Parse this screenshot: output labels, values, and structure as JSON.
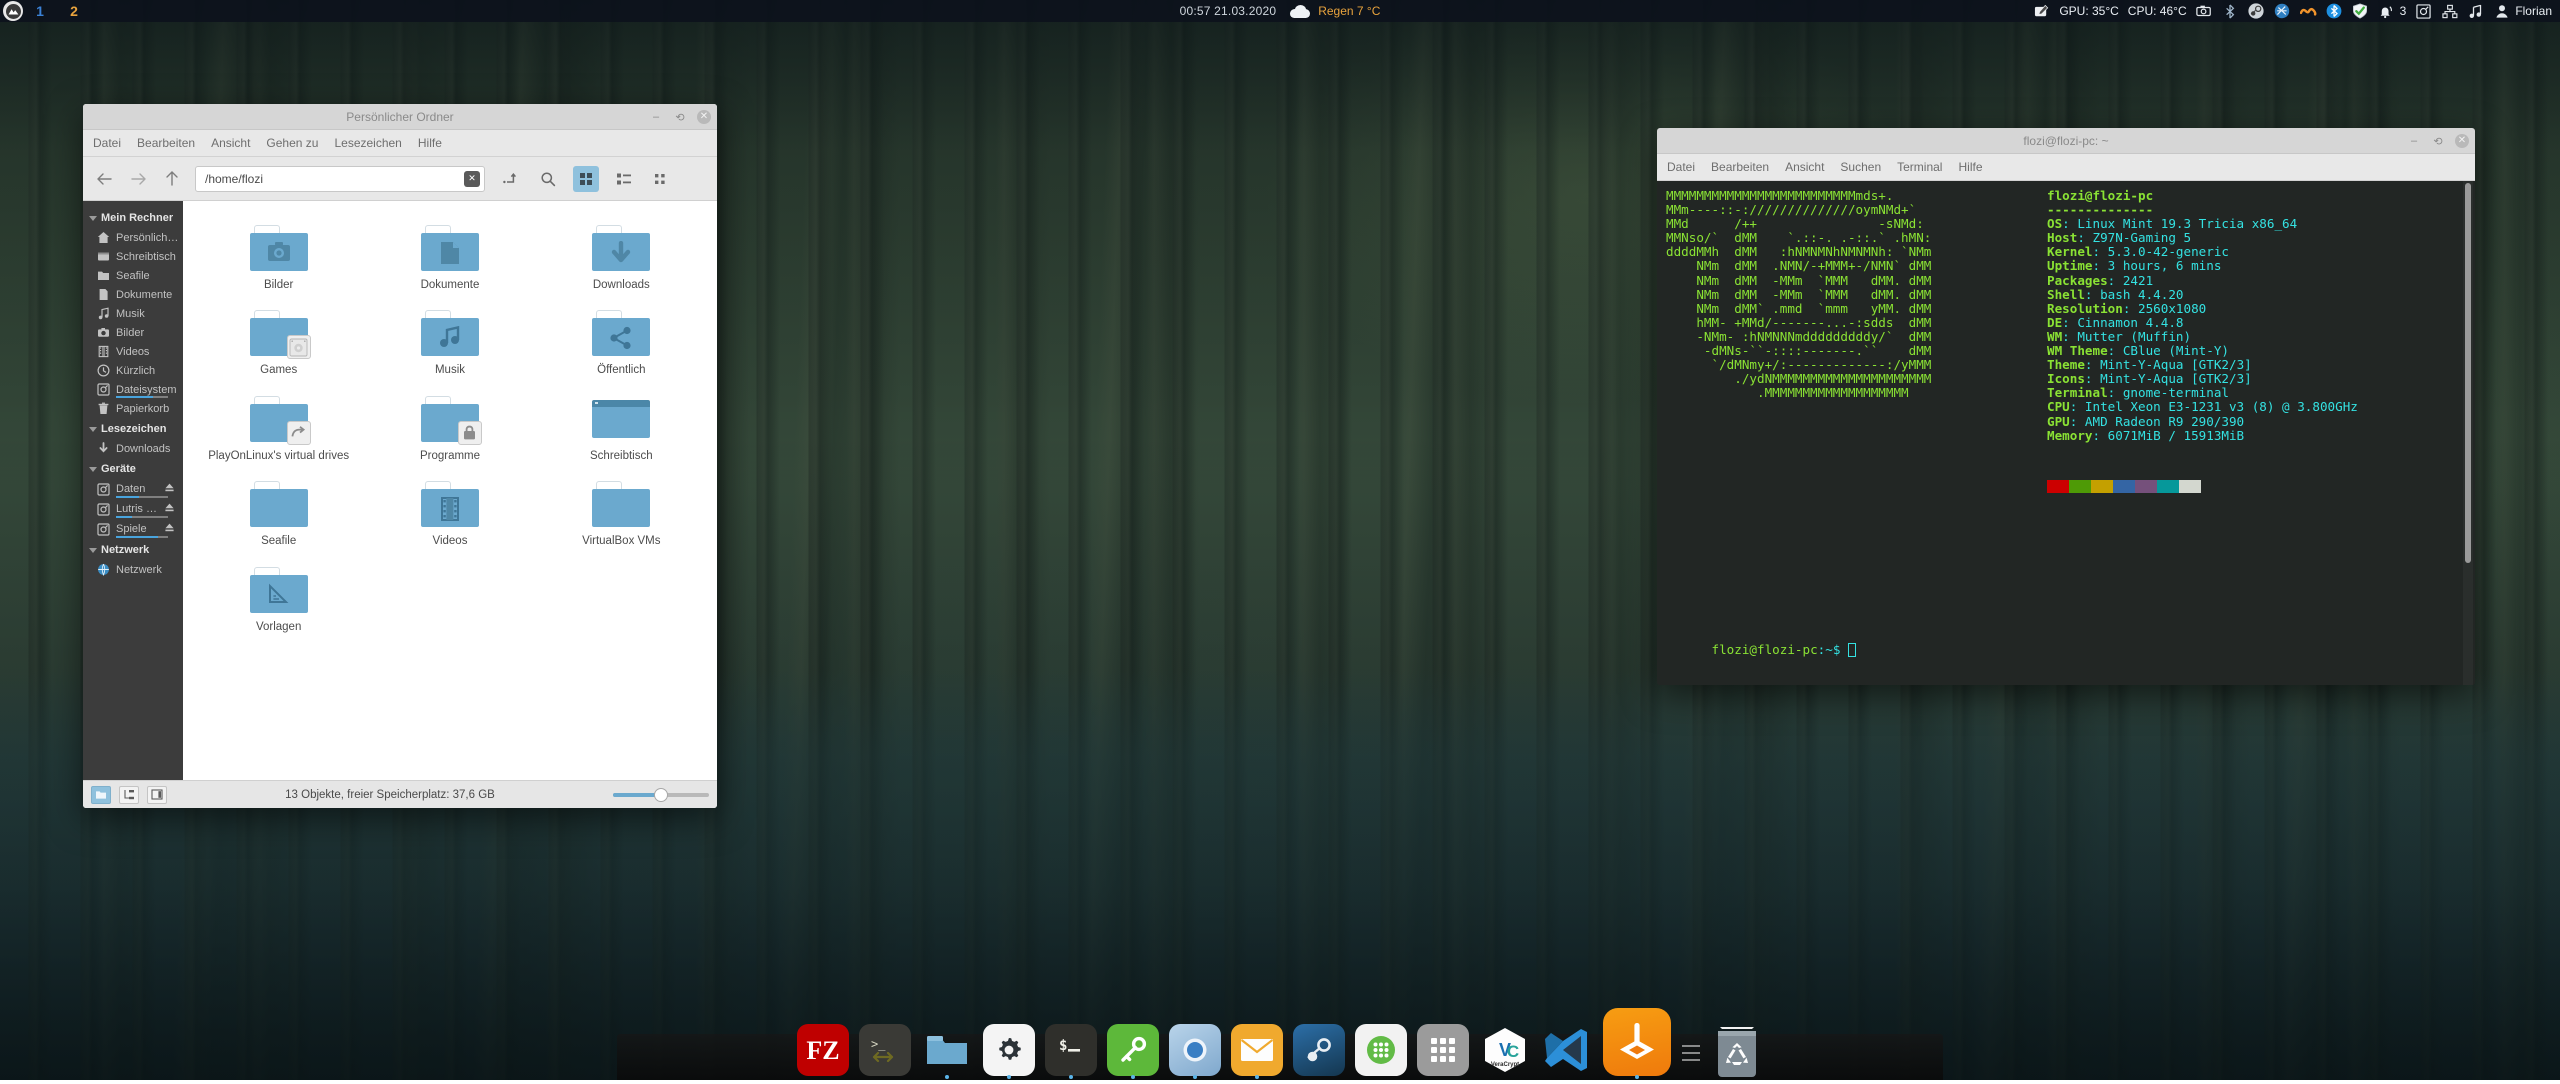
{
  "panel": {
    "menu_icon": "mint-logo-icon",
    "workspaces": [
      {
        "label": "1",
        "active": true
      },
      {
        "label": "2",
        "active": false
      }
    ],
    "clock": "00:57  21.03.2020",
    "weather": {
      "icon": "cloud-icon",
      "text": "Regen 7 °C"
    },
    "tray": {
      "gpu": "GPU: 35°C",
      "cpu": "CPU: 46°C",
      "notification_count": "3",
      "icons": [
        "screenshot-pen-icon",
        "camera-icon",
        "bluetooth-small-icon",
        "steam-icon",
        "synergy-icon",
        "nextcloud-icon",
        "bluetooth-icon",
        "shield-check-icon",
        "bell-icon",
        "removable-drive-icon",
        "network-icon",
        "audio-icon"
      ],
      "user": "Florian",
      "user_icon": "user-avatar-icon"
    }
  },
  "nemo": {
    "title": "Persönlicher Ordner",
    "menu": [
      "Datei",
      "Bearbeiten",
      "Ansicht",
      "Gehen zu",
      "Lesezeichen",
      "Hilfe"
    ],
    "window_buttons": {
      "minimize": "–",
      "maximize": "⟲",
      "close": "✕"
    },
    "path": "/home/flozi",
    "toolbar_icons": [
      "back-icon",
      "forward-icon",
      "up-icon",
      "clear-icon",
      "terminal-here-icon",
      "search-icon",
      "icon-view-icon",
      "list-view-icon",
      "compact-view-icon"
    ],
    "sidebar": [
      {
        "type": "header",
        "label": "Mein Rechner"
      },
      {
        "type": "item",
        "label": "Persönliche…",
        "icon": "home-icon"
      },
      {
        "type": "item",
        "label": "Schreibtisch",
        "icon": "desktop-icon"
      },
      {
        "type": "item",
        "label": "Seafile",
        "icon": "folder-icon"
      },
      {
        "type": "item",
        "label": "Dokumente",
        "icon": "document-icon"
      },
      {
        "type": "item",
        "label": "Musik",
        "icon": "music-note-icon"
      },
      {
        "type": "item",
        "label": "Bilder",
        "icon": "camera-icon"
      },
      {
        "type": "item",
        "label": "Videos",
        "icon": "film-icon"
      },
      {
        "type": "item",
        "label": "Kürzlich",
        "icon": "clock-icon"
      },
      {
        "type": "item",
        "label": "Dateisystem",
        "icon": "drive-icon",
        "usage": 72
      },
      {
        "type": "item",
        "label": "Papierkorb",
        "icon": "trash-icon"
      },
      {
        "type": "header",
        "label": "Lesezeichen"
      },
      {
        "type": "item",
        "label": "Downloads",
        "icon": "download-icon"
      },
      {
        "type": "header",
        "label": "Geräte"
      },
      {
        "type": "item",
        "label": "Daten",
        "icon": "drive-icon",
        "usage": 45,
        "eject": true
      },
      {
        "type": "item",
        "label": "Lutris Games",
        "icon": "drive-icon",
        "usage": 30,
        "eject": true
      },
      {
        "type": "item",
        "label": "Spiele",
        "icon": "drive-icon",
        "usage": 80,
        "eject": true
      },
      {
        "type": "header",
        "label": "Netzwerk"
      },
      {
        "type": "item",
        "label": "Netzwerk",
        "icon": "globe-icon"
      }
    ],
    "files": [
      {
        "name": "Bilder",
        "kind": "folder",
        "emblem": "camera-icon"
      },
      {
        "name": "Dokumente",
        "kind": "folder",
        "emblem": "document-icon"
      },
      {
        "name": "Downloads",
        "kind": "folder",
        "emblem": "download-arrow-icon"
      },
      {
        "name": "Games",
        "kind": "folder",
        "emblem": "none",
        "badge": "drive-badge-icon"
      },
      {
        "name": "Musik",
        "kind": "folder",
        "emblem": "music-note-icon"
      },
      {
        "name": "Öffentlich",
        "kind": "folder",
        "emblem": "share-icon"
      },
      {
        "name": "PlayOnLinux's virtual drives",
        "kind": "folder",
        "emblem": "none",
        "badge": "link-badge-icon"
      },
      {
        "name": "Programme",
        "kind": "folder",
        "emblem": "none",
        "badge": "lock-badge-icon"
      },
      {
        "name": "Schreibtisch",
        "kind": "desktop",
        "emblem": "none"
      },
      {
        "name": "Seafile",
        "kind": "folder",
        "emblem": "none"
      },
      {
        "name": "Videos",
        "kind": "folder",
        "emblem": "film-icon"
      },
      {
        "name": "VirtualBox VMs",
        "kind": "folder",
        "emblem": "none"
      },
      {
        "name": "Vorlagen",
        "kind": "folder",
        "emblem": "ruler-icon"
      }
    ],
    "status": "13 Objekte, freier Speicherplatz: 37,6 GB",
    "zoom_percent": 50,
    "status_buttons": [
      "icon-view-toggle",
      "tree-view-toggle",
      "sidebar-toggle"
    ]
  },
  "terminal": {
    "title": "flozi@flozi-pc: ~",
    "menu": [
      "Datei",
      "Bearbeiten",
      "Ansicht",
      "Suchen",
      "Terminal",
      "Hilfe"
    ],
    "window_buttons": {
      "minimize": "–",
      "maximize": "⟲",
      "close": "✕"
    },
    "ascii_art": "MMMMMMMMMMMMMMMMMMMMMMMMMmds+.\nMMm----::-://////////////oymNMd+`\nMMd      /++                -sNMd:\nMMNso/`  dMM    `.::-. .-::.` .hMN:\nddddMMh  dMM   :hNMNMNhNMNMNh: `NMm\n    NMm  dMM  .NMN/-+MMM+-/NMN` dMM\n    NMm  dMM  -MMm  `MMM   dMM. dMM\n    NMm  dMM  -MMm  `MMM   dMM. dMM\n    NMm  dMM` .mmd  `mmm   yMM. dMM\n    hMM- +MMd/-------...-:sdds  dMM\n    -NMm- :hNMNNNmdddddddddy/`  dMM\n     -dMNs-``-::::-------.``    dMM\n      `/dMNmy+/:-------------:/yMMM\n         ./ydNMMMMMMMMMMMMMMMMMMMMM\n            .MMMMMMMMMMMMMMMMMMM",
    "neofetch": {
      "user_host": "flozi@flozi-pc",
      "separator": "--------------",
      "fields": [
        {
          "key": "OS",
          "value": "Linux Mint 19.3 Tricia x86_64"
        },
        {
          "key": "Host",
          "value": "Z97N-Gaming 5"
        },
        {
          "key": "Kernel",
          "value": "5.3.0-42-generic"
        },
        {
          "key": "Uptime",
          "value": "3 hours, 6 mins"
        },
        {
          "key": "Packages",
          "value": "2421"
        },
        {
          "key": "Shell",
          "value": "bash 4.4.20"
        },
        {
          "key": "Resolution",
          "value": "2560x1080"
        },
        {
          "key": "DE",
          "value": "Cinnamon 4.4.8"
        },
        {
          "key": "WM",
          "value": "Mutter (Muffin)"
        },
        {
          "key": "WM Theme",
          "value": "CBlue (Mint-Y)"
        },
        {
          "key": "Theme",
          "value": "Mint-Y-Aqua [GTK2/3]"
        },
        {
          "key": "Icons",
          "value": "Mint-Y-Aqua [GTK2/3]"
        },
        {
          "key": "Terminal",
          "value": "gnome-terminal"
        },
        {
          "key": "CPU",
          "value": "Intel Xeon E3-1231 v3 (8) @ 3.800GHz"
        },
        {
          "key": "GPU",
          "value": "AMD Radeon R9 290/390"
        },
        {
          "key": "Memory",
          "value": "6071MiB / 15913MiB"
        }
      ],
      "swatches": [
        "#cc0000",
        "#4e9a06",
        "#c4a000",
        "#3465a4",
        "#75507b",
        "#06989a",
        "#d3d7cf"
      ]
    },
    "prompt_user": "flozi@flozi-pc",
    "prompt_path": ":~$",
    "colors": {
      "key": "#8ae234",
      "value": "#34e2e2",
      "prompt": "#8ae234"
    }
  },
  "dock": {
    "items": [
      {
        "name": "filezilla",
        "label": "FileZilla"
      },
      {
        "name": "guake-terminal",
        "label": "Terminal"
      },
      {
        "name": "nemo-files",
        "label": "Dateien"
      },
      {
        "name": "system-settings",
        "label": "Systemeinstellungen"
      },
      {
        "name": "terminal",
        "label": "Terminal"
      },
      {
        "name": "keepassxc",
        "label": "KeePassXC"
      },
      {
        "name": "chromium",
        "label": "Chromium"
      },
      {
        "name": "thunderbird-mail",
        "label": "Mail"
      },
      {
        "name": "steam",
        "label": "Steam"
      },
      {
        "name": "app-green",
        "label": "Anwendung"
      },
      {
        "name": "app-grid",
        "label": "Anwendungen"
      },
      {
        "name": "veracrypt",
        "label": "VeraCrypt"
      },
      {
        "name": "vscode",
        "label": "Visual Studio Code"
      },
      {
        "name": "lutris",
        "label": "Lutris"
      },
      {
        "name": "separator",
        "label": ""
      },
      {
        "name": "trash",
        "label": "Papierkorb"
      }
    ]
  }
}
